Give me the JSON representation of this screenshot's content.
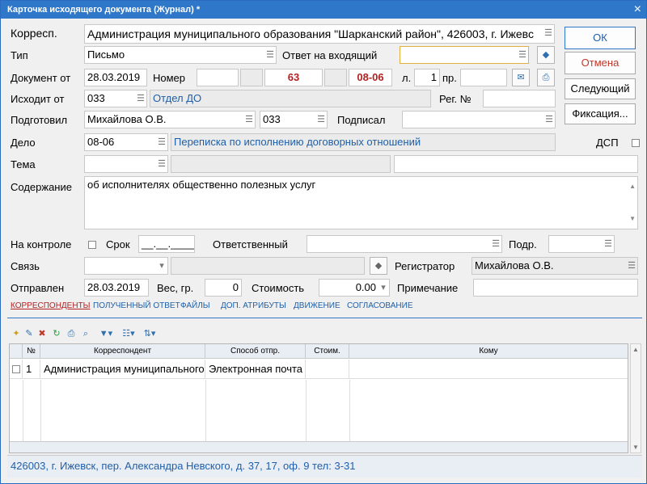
{
  "window": {
    "title": "Карточка исходящего документа (Журнал) *",
    "close": "×"
  },
  "form": {
    "corresp_label": "Корресп.",
    "corresp_value": "Администрация муниципального образования \"Шарканский район\", 426003, г. Ижевс",
    "type_label": "Тип",
    "type_value": "Письмо",
    "reply_label": "Ответ на входящий",
    "reply_value": "",
    "doc_from_label": "Документ от",
    "doc_date": "28.03.2019",
    "number_label": "Номер",
    "number_value": "63",
    "number_suffix": "08-06",
    "sheets_label": "л.",
    "sheets_value": "1",
    "att_label": "пр.",
    "att_value": "",
    "issued_label": "Исходит от",
    "issued_code": "033",
    "issued_name": "Отдел ДО",
    "reg_label": "Рег. №",
    "reg_value": "",
    "prepared_label": "Подготовил",
    "prepared_name": "Михайлова О.В.",
    "prepared_code": "033",
    "signed_label": "Подписал",
    "signed_value": "",
    "case_label": "Дело",
    "case_code": "08-06",
    "case_name": "Переписка по исполнению договорных отношений",
    "dsp_label": "ДСП",
    "theme_label": "Тема",
    "theme_value": "",
    "content_label": "Содержание",
    "content_value": "об исполнителях общественно полезных услуг",
    "control_label": "На контроле",
    "term_label": "Срок",
    "term_value": "__.__.____",
    "responsible_label": "Ответственный",
    "responsible_value": "",
    "dept_label": "Подр.",
    "dept_value": "",
    "link_label": "Связь",
    "link_value": "",
    "registrar_label": "Регистратор",
    "registrar_value": "Михайлова О.В.",
    "sent_label": "Отправлен",
    "sent_date": "28.03.2019",
    "weight_label": "Вес, гр.",
    "weight_value": "0",
    "cost_label": "Стоимость",
    "cost_value": "0.00",
    "note_label": "Примечание",
    "note_value": ""
  },
  "buttons": {
    "ok": "ОК",
    "cancel": "Отмена",
    "next": "Следующий",
    "fix": "Фиксация..."
  },
  "tabs": [
    "КОРРЕСПОНДЕНТЫ",
    "ПОЛУЧЕННЫЙ ОТВЕТ",
    "ФАЙЛЫ",
    "ДОП. АТРИБУТЫ",
    "ДВИЖЕНИЕ",
    "СОГЛАСОВАНИЕ"
  ],
  "grid": {
    "columns": [
      "№",
      "Корреспондент",
      "Способ отпр.",
      "Стоим.",
      "Кому"
    ],
    "rows": [
      {
        "num": "1",
        "correspondent": "Администрация муниципального",
        "method": "Электронная почта",
        "cost": "",
        "to": ""
      }
    ]
  },
  "status": "426003, г. Ижевск, пер. Александра Невского,  д. 37,  17,  оф. 9   тел: 3-31",
  "colors": {
    "title_bar": "#2f78c9",
    "link_blue": "#1f5fa8",
    "accent_red": "#b22222"
  },
  "icons": [
    "dropdown-icon",
    "eraser-icon",
    "stamp-icon",
    "scanner-icon",
    "new-icon",
    "edit-icon",
    "delete-icon",
    "refresh-icon",
    "print-icon",
    "search-icon",
    "filter-icon",
    "columns-icon",
    "sort-icon"
  ]
}
